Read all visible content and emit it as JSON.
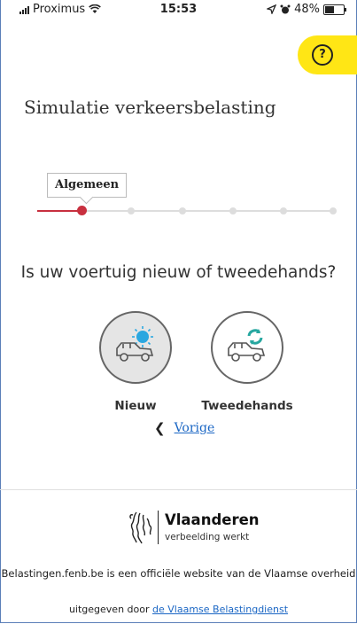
{
  "status_bar": {
    "carrier": "Proximus",
    "time": "15:53",
    "battery": "48%",
    "battery_level": 0.48
  },
  "help": {
    "label": "?"
  },
  "page_title": "Simulatie verkeersbelasting",
  "stepper": {
    "current_label": "Algemeen",
    "total_steps": 6,
    "current_step": 1
  },
  "question": "Is uw voertuig nieuw of tweedehands?",
  "choices": [
    {
      "label": "Nieuw",
      "icon": "new-car-icon",
      "selected": true
    },
    {
      "label": "Tweedehands",
      "icon": "used-car-icon",
      "selected": false
    }
  ],
  "nav": {
    "previous_label": "Vorige"
  },
  "footer": {
    "brand": "Vlaanderen",
    "tagline": "verbeelding werkt",
    "line1": "Belastingen.fenb.be is een officiële website van de Vlaamse overheid",
    "line2_prefix": "uitgegeven door ",
    "line2_link": "de Vlaamse Belastingdienst"
  },
  "colors": {
    "accent_yellow": "#ffe615",
    "step_active": "#c8303f",
    "link": "#1a66c4",
    "sun_blue": "#2aa7e0",
    "recycle_teal": "#27a7a0"
  }
}
